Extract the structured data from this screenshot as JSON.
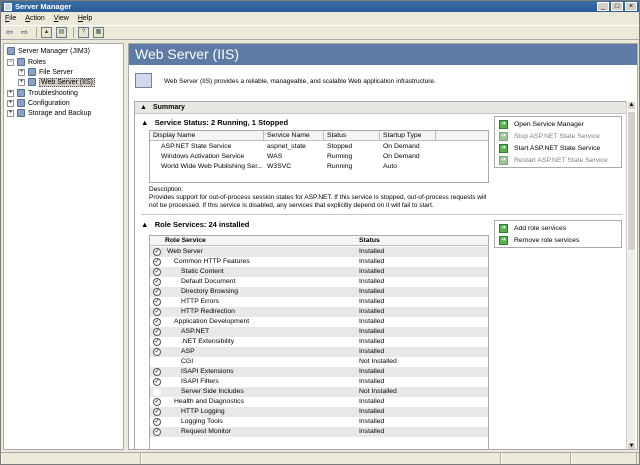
{
  "window": {
    "title": "Server Manager",
    "controls": [
      "_",
      "□",
      "×"
    ]
  },
  "menu": [
    "File",
    "Action",
    "View",
    "Help"
  ],
  "toolbar": {
    "icons": [
      "back-arrow-icon",
      "forward-arrow-icon",
      "up-folder-icon",
      "show-hide-tree-icon",
      "help-icon",
      "properties-icon"
    ]
  },
  "tree": {
    "root": "Server Manager (JIM3)",
    "items": [
      {
        "label": "Roles",
        "expander": "−"
      },
      {
        "label": "File Server",
        "expander": "+"
      },
      {
        "label": "Web Server (IIS)",
        "expander": "+"
      },
      {
        "label": "Troubleshooting",
        "expander": "+"
      },
      {
        "label": "Configuration",
        "expander": "+"
      },
      {
        "label": "Storage and Backup",
        "expander": "+"
      }
    ]
  },
  "page": {
    "title": "Web Server (IIS)",
    "intro": "Web Server (IIS) provides a reliable, manageable, and scalable Web application infrastructure."
  },
  "summary": {
    "header": "Summary",
    "status_title": "Service Status: 2 Running, 1 Stopped",
    "columns": [
      "Display Name",
      "Service Name",
      "Status",
      "Startup Type"
    ],
    "rows": [
      [
        "ASP.NET State Service",
        "aspnet_state",
        "Stopped",
        "On Demand"
      ],
      [
        "Windows Activation Service",
        "WAS",
        "Running",
        "On Demand"
      ],
      [
        "World Wide Web Publishing Ser...",
        "W3SVC",
        "Running",
        "Auto"
      ]
    ],
    "description_label": "Description:",
    "description": "Provides support for out-of-process session states for ASP.NET. If this service is stopped, out-of-process requests will not be processed. If this service is disabled, any services that explicitly depend on it will fail to start.",
    "tasks": [
      {
        "label": "Open Service Manager",
        "enabled": true
      },
      {
        "label": "Stop ASP.NET State Service",
        "enabled": false
      },
      {
        "label": "Start ASP.NET State Service",
        "enabled": true
      },
      {
        "label": "Restart ASP.NET State Service",
        "enabled": false
      }
    ]
  },
  "role_services": {
    "title": "Role Services: 24 installed",
    "columns": [
      "Role Service",
      "Status"
    ],
    "rows": [
      {
        "name": "Web Server",
        "status": "Installed",
        "level": 0,
        "checked": true
      },
      {
        "name": "Common HTTP Features",
        "status": "Installed",
        "level": 1,
        "checked": true
      },
      {
        "name": "Static Content",
        "status": "Installed",
        "level": 2,
        "checked": true
      },
      {
        "name": "Default Document",
        "status": "Installed",
        "level": 2,
        "checked": true
      },
      {
        "name": "Directory Browsing",
        "status": "Installed",
        "level": 2,
        "checked": true
      },
      {
        "name": "HTTP Errors",
        "status": "Installed",
        "level": 2,
        "checked": true
      },
      {
        "name": "HTTP Redirection",
        "status": "Installed",
        "level": 2,
        "checked": true
      },
      {
        "name": "Application Development",
        "status": "Installed",
        "level": 1,
        "checked": true
      },
      {
        "name": "ASP.NET",
        "status": "Installed",
        "level": 2,
        "checked": true
      },
      {
        "name": ".NET Extensibility",
        "status": "Installed",
        "level": 2,
        "checked": true
      },
      {
        "name": "ASP",
        "status": "Installed",
        "level": 2,
        "checked": true
      },
      {
        "name": "CGI",
        "status": "Not Installed",
        "level": 2,
        "checked": false
      },
      {
        "name": "ISAPI Extensions",
        "status": "Installed",
        "level": 2,
        "checked": true
      },
      {
        "name": "ISAPI Filters",
        "status": "Installed",
        "level": 2,
        "checked": true
      },
      {
        "name": "Server Side Includes",
        "status": "Not Installed",
        "level": 2,
        "checked": false
      },
      {
        "name": "Health and Diagnostics",
        "status": "Installed",
        "level": 1,
        "checked": true
      },
      {
        "name": "HTTP Logging",
        "status": "Installed",
        "level": 2,
        "checked": true
      },
      {
        "name": "Logging Tools",
        "status": "Installed",
        "level": 2,
        "checked": true
      },
      {
        "name": "Request Monitor",
        "status": "Installed",
        "level": 2,
        "checked": true
      }
    ],
    "tasks": [
      {
        "label": "Add role services",
        "enabled": true
      },
      {
        "label": "Remove role services",
        "enabled": true
      }
    ]
  },
  "colors": {
    "header_bar": "#5d7ba4",
    "task_icon": "#56b34d",
    "title_bar": "#2a5d9a"
  }
}
